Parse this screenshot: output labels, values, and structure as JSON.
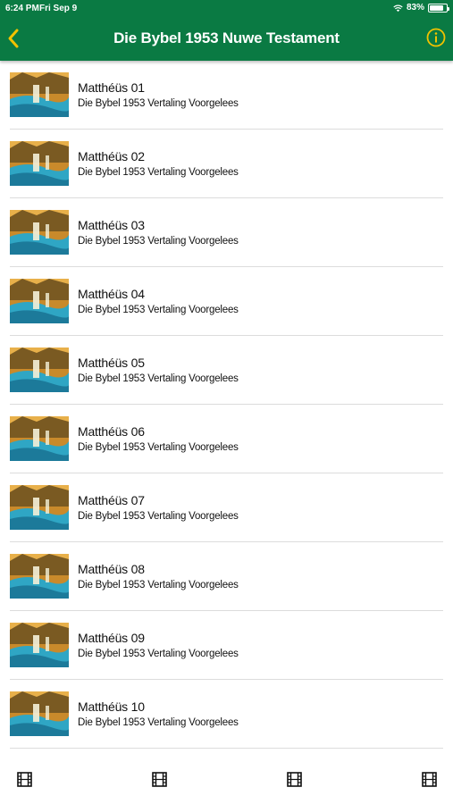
{
  "status": {
    "time": "6:24 PM",
    "date": "Fri Sep 9",
    "battery": "83%"
  },
  "header": {
    "title": "Die Bybel 1953 Nuwe Testament",
    "accent": "#0a7a43",
    "icon_color": "#f2c200",
    "back_icon": "chevron-left-icon",
    "info_icon": "info-circle-icon"
  },
  "items": [
    {
      "title": "Matthéüs 01",
      "subtitle": "Die Bybel 1953 Vertaling Voorgelees"
    },
    {
      "title": "Matthéüs 02",
      "subtitle": "Die Bybel 1953 Vertaling Voorgelees"
    },
    {
      "title": "Matthéüs 03",
      "subtitle": "Die Bybel 1953 Vertaling Voorgelees"
    },
    {
      "title": "Matthéüs 04",
      "subtitle": "Die Bybel 1953 Vertaling Voorgelees"
    },
    {
      "title": "Matthéüs 05",
      "subtitle": "Die Bybel 1953 Vertaling Voorgelees"
    },
    {
      "title": "Matthéüs 06",
      "subtitle": "Die Bybel 1953 Vertaling Voorgelees"
    },
    {
      "title": "Matthéüs 07",
      "subtitle": "Die Bybel 1953 Vertaling Voorgelees"
    },
    {
      "title": "Matthéüs 08",
      "subtitle": "Die Bybel 1953 Vertaling Voorgelees"
    },
    {
      "title": "Matthéüs 09",
      "subtitle": "Die Bybel 1953 Vertaling Voorgelees"
    },
    {
      "title": "Matthéüs 10",
      "subtitle": "Die Bybel 1953 Vertaling Voorgelees"
    }
  ],
  "bottom_tabs": [
    {
      "icon": "film-icon"
    },
    {
      "icon": "film-icon"
    },
    {
      "icon": "film-icon"
    },
    {
      "icon": "film-icon"
    }
  ]
}
